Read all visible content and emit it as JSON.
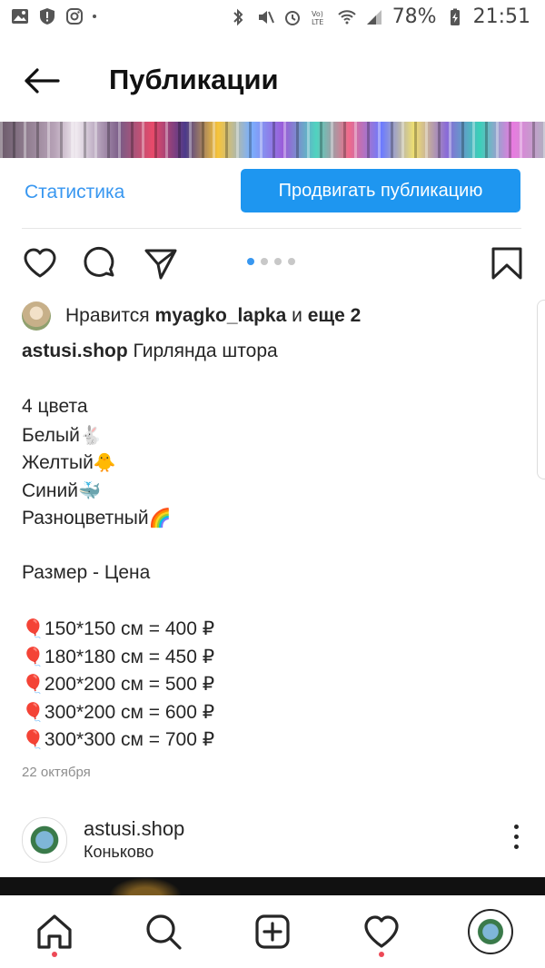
{
  "status_bar": {
    "battery": "78%",
    "time": "21:51"
  },
  "header": {
    "title": "Публикации"
  },
  "actions": {
    "statistics_label": "Статистика",
    "promote_label": "Продвигать публикацию"
  },
  "carousel": {
    "dot_count": 4,
    "active_index": 0
  },
  "likes": {
    "prefix": "Нравится",
    "user": "myagko_lapka",
    "connector": "и",
    "more": "еще 2"
  },
  "caption": {
    "username": "astusi.shop",
    "title": "Гирлянда штора",
    "colors_heading": "4 цвета",
    "colors": [
      {
        "name": "Белый",
        "emoji": "🐇"
      },
      {
        "name": "Желтый",
        "emoji": "🐥"
      },
      {
        "name": "Синий",
        "emoji": "🐳"
      },
      {
        "name": "Разноцветный",
        "emoji": "🌈"
      }
    ],
    "size_heading": "Размер - Цена",
    "price_emoji": "🎈",
    "prices": [
      "150*150 см = 400 ₽",
      "180*180 см = 450 ₽",
      "200*200 см = 500 ₽",
      "300*200 см = 600 ₽",
      "300*300 см = 700 ₽"
    ],
    "date": "22 октября"
  },
  "next_post": {
    "username": "astusi.shop",
    "location": "Коньково"
  },
  "icons": {
    "back": "arrow-left-icon",
    "like": "heart-icon",
    "comment": "comment-icon",
    "share": "send-icon",
    "save": "bookmark-icon",
    "nav": [
      "home-icon",
      "search-icon",
      "add-post-icon",
      "activity-heart-icon",
      "profile-avatar"
    ]
  },
  "colors": {
    "accent": "#3897f0",
    "promote_button": "#1e96f0",
    "notification_dot": "#ed4956"
  }
}
